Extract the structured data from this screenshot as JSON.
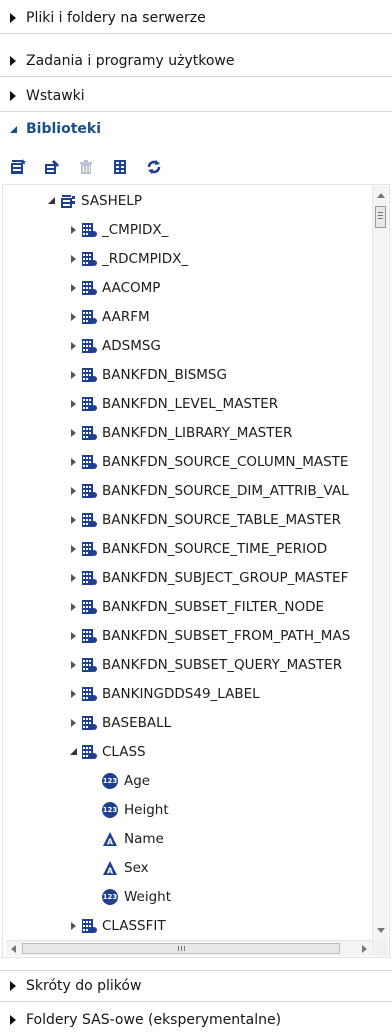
{
  "panels": {
    "files": "Pliki i foldery na serwerze",
    "tasks": "Zadania i programy użytkowe",
    "snippets": "Wstawki",
    "libraries": "Biblioteki",
    "shortcuts": "Skróty do plików",
    "sas_folders": "Foldery SAS-owe (eksperymentalne)"
  },
  "toolbar": {
    "icons": [
      "new-library-icon",
      "library-properties-icon",
      "delete-icon",
      "view-table-icon",
      "refresh-icon"
    ]
  },
  "tree": {
    "library": "SASHELP",
    "tables": [
      "_CMPIDX_",
      "_RDCMPIDX_",
      "AACOMP",
      "AARFM",
      "ADSMSG",
      "BANKFDN_BISMSG",
      "BANKFDN_LEVEL_MASTER",
      "BANKFDN_LIBRARY_MASTER",
      "BANKFDN_SOURCE_COLUMN_MASTE",
      "BANKFDN_SOURCE_DIM_ATTRIB_VAL",
      "BANKFDN_SOURCE_TABLE_MASTER",
      "BANKFDN_SOURCE_TIME_PERIOD",
      "BANKFDN_SUBJECT_GROUP_MASTEF",
      "BANKFDN_SUBSET_FILTER_NODE",
      "BANKFDN_SUBSET_FROM_PATH_MAS",
      "BANKFDN_SUBSET_QUERY_MASTER",
      "BANKINGDDS49_LABEL",
      "BASEBALL"
    ],
    "expanded_table": "CLASS",
    "columns": [
      {
        "name": "Age",
        "type": "numeric",
        "badge": "123"
      },
      {
        "name": "Height",
        "type": "numeric",
        "badge": "123"
      },
      {
        "name": "Name",
        "type": "character",
        "badge": "A"
      },
      {
        "name": "Sex",
        "type": "character",
        "badge": "A"
      },
      {
        "name": "Weight",
        "type": "numeric",
        "badge": "123"
      }
    ],
    "after_table": "CLASSFIT"
  },
  "colors": {
    "accent": "#1a4f8f",
    "icon": "#1f3f8f"
  }
}
